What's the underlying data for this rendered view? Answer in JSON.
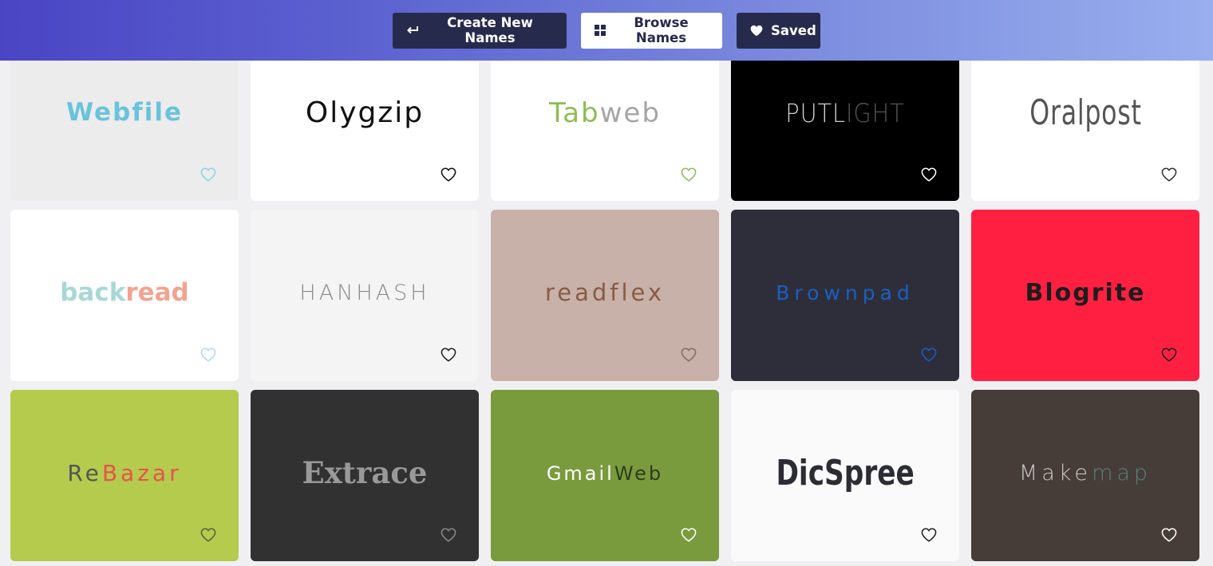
{
  "nav": {
    "create_label": "Create New Names",
    "browse_label": "Browse Names",
    "saved_label": "Saved"
  },
  "cards": [
    {
      "name": "Webfile",
      "bg": "#ececec",
      "text_color": "#6ac3dc",
      "heart_color": "#8fd3e6"
    },
    {
      "name": "Olygzip",
      "bg": "#ffffff",
      "text_color": "#111111",
      "heart_color": "#111111"
    },
    {
      "name_part1": "Tab",
      "name_part2": "web",
      "bg": "#ffffff",
      "text_color": "#8cbd54",
      "text_color2": "#a5a5a5",
      "heart_color": "#8cbd54"
    },
    {
      "name_part1": "PUTL",
      "name_part2": "IGHT",
      "bg": "#000000",
      "text_color": "#cfcfcf",
      "text_color2": "#555555",
      "heart_color": "#ffffff"
    },
    {
      "name": "Oralpost",
      "bg": "#ffffff",
      "text_color": "#555555",
      "heart_color": "#333333"
    },
    {
      "name_part1": "back",
      "name_part2": "read",
      "bg": "#ffffff",
      "text_color": "#a8d8d6",
      "text_color2": "#f2a38f",
      "heart_color": "#a8dde6"
    },
    {
      "name": "HANHASH",
      "bg": "#f4f4f4",
      "text_color": "#8a8a8a",
      "heart_color": "#222222"
    },
    {
      "name": "readflex",
      "bg": "#c7b1a8",
      "text_color": "#8a5a45",
      "heart_color": "#8a6a5e"
    },
    {
      "name": "Brownpad",
      "bg": "#2e2e3b",
      "text_color": "#1a5fc0",
      "heart_color": "#1a5fc0"
    },
    {
      "name": "Blogrite",
      "bg": "#ff2041",
      "text_color": "#1d1d1d",
      "heart_color": "#1d1d1d"
    },
    {
      "name_part1": "Re",
      "name_part2": "Bazar",
      "bg": "#b4cb4e",
      "text_color": "#555555",
      "text_color2": "#e8524a",
      "heart_color": "#5a5f3a"
    },
    {
      "name": "Extrace",
      "bg": "#313131",
      "text_color": "#999999",
      "heart_color": "#8a8a8a"
    },
    {
      "name_part1": "Gmail",
      "name_part2": "Web",
      "bg": "#7a9a3e",
      "text_color": "#ffffff",
      "text_color2": "#2d3d18",
      "heart_color": "#ffffff"
    },
    {
      "name": "DicSpree",
      "bg": "#fafafa",
      "text_color": "#2c2c35",
      "heart_color": "#222222"
    },
    {
      "name_part1": "Make",
      "name_part2": "map",
      "bg": "#463d38",
      "text_color": "#c8c8c8",
      "text_color2": "#5a7f7c",
      "heart_color": "#ffffff"
    }
  ]
}
